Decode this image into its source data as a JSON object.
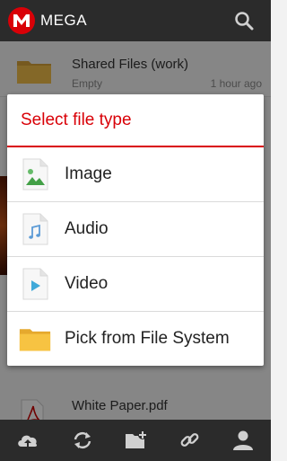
{
  "header": {
    "app_title": "MEGA",
    "logo_letter": "M",
    "search_icon": "search-icon"
  },
  "files": [
    {
      "name": "Shared Files (work)",
      "subtitle": "Empty",
      "time": "1 hour ago",
      "icon": "folder-icon"
    },
    {
      "name": "White Paper.pdf",
      "icon": "pdf-icon"
    }
  ],
  "dialog": {
    "title": "Select file type",
    "options": [
      {
        "label": "Image",
        "icon": "image-file-icon"
      },
      {
        "label": "Audio",
        "icon": "audio-file-icon"
      },
      {
        "label": "Video",
        "icon": "video-file-icon"
      },
      {
        "label": "Pick from File System",
        "icon": "folder-icon"
      }
    ]
  },
  "bottom_bar": {
    "buttons": [
      "upload-icon",
      "sync-icon",
      "new-folder-icon",
      "link-icon",
      "account-icon"
    ]
  },
  "colors": {
    "accent": "#d90007",
    "bar_background": "#2b2b2b",
    "folder": "#f5b82e"
  }
}
